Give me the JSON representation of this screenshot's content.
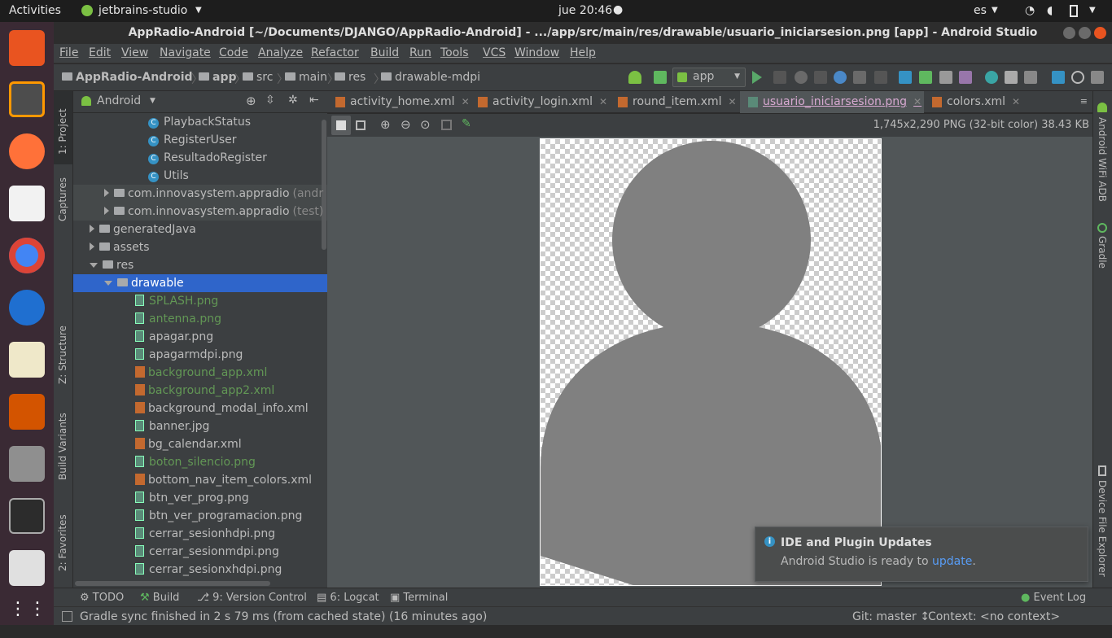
{
  "topbar": {
    "activities": "Activities",
    "app_name": "jetbrains-studio",
    "clock": "jue 20:46",
    "language": "es"
  },
  "dock": {
    "apps": [
      "software-store-icon",
      "sublime-text-icon",
      "firefox-icon",
      "document-viewer-icon",
      "chrome-icon",
      "thunderbird-icon",
      "text-editor-icon",
      "presentation-icon",
      "files-icon",
      "terminal-icon",
      "amazon-icon",
      "app-grid-icon"
    ]
  },
  "window": {
    "title": "AppRadio-Android [~/Documents/DJANGO/AppRadio-Android] - .../app/src/main/res/drawable/usuario_iniciarsesion.png [app] - Android Studio"
  },
  "menu": [
    "File",
    "Edit",
    "View",
    "Navigate",
    "Code",
    "Analyze",
    "Refactor",
    "Build",
    "Run",
    "Tools",
    "VCS",
    "Window",
    "Help"
  ],
  "breadcrumbs": [
    "AppRadio-Android",
    "app",
    "src",
    "main",
    "res",
    "drawable-mdpi"
  ],
  "run_config": "app",
  "left_tools": {
    "project": "1: Project",
    "captures": "Captures",
    "structure": "Z: Structure",
    "build_variants": "Build Variants",
    "favorites": "2: Favorites"
  },
  "project_panel": {
    "view_mode": "Android",
    "items": [
      {
        "label": "PlaybackStatus",
        "kind": "class",
        "depth": 5
      },
      {
        "label": "RegisterUser",
        "kind": "class",
        "depth": 5
      },
      {
        "label": "ResultadoRegister",
        "kind": "class",
        "depth": 5
      },
      {
        "label": "Utils",
        "kind": "class",
        "depth": 5
      },
      {
        "label": "com.innovasystem.appradio",
        "suffix": "(andr",
        "kind": "package",
        "depth": 2
      },
      {
        "label": "com.innovasystem.appradio",
        "suffix": "(test)",
        "kind": "package",
        "depth": 2
      },
      {
        "label": "generatedJava",
        "kind": "folder",
        "depth": 1
      },
      {
        "label": "assets",
        "kind": "folder",
        "depth": 1
      },
      {
        "label": "res",
        "kind": "folder-open",
        "depth": 1
      },
      {
        "label": "drawable",
        "kind": "folder-open",
        "depth": 2,
        "selected": true
      },
      {
        "label": "SPLASH.png",
        "kind": "png",
        "depth": 4,
        "green": true
      },
      {
        "label": "antenna.png",
        "kind": "png",
        "depth": 4,
        "green": true
      },
      {
        "label": "apagar.png",
        "kind": "png",
        "depth": 4
      },
      {
        "label": "apagarmdpi.png",
        "kind": "png",
        "depth": 4
      },
      {
        "label": "background_app.xml",
        "kind": "xml",
        "depth": 4,
        "green": true
      },
      {
        "label": "background_app2.xml",
        "kind": "xml",
        "depth": 4,
        "green": true
      },
      {
        "label": "background_modal_info.xml",
        "kind": "xml",
        "depth": 4
      },
      {
        "label": "banner.jpg",
        "kind": "png",
        "depth": 4
      },
      {
        "label": "bg_calendar.xml",
        "kind": "xml",
        "depth": 4
      },
      {
        "label": "boton_silencio.png",
        "kind": "png",
        "depth": 4,
        "green": true
      },
      {
        "label": "bottom_nav_item_colors.xml",
        "kind": "xml",
        "depth": 4
      },
      {
        "label": "btn_ver_prog.png",
        "kind": "png",
        "depth": 4
      },
      {
        "label": "btn_ver_programacion.png",
        "kind": "png",
        "depth": 4
      },
      {
        "label": "cerrar_sesionhdpi.png",
        "kind": "png",
        "depth": 4
      },
      {
        "label": "cerrar_sesionmdpi.png",
        "kind": "png",
        "depth": 4
      },
      {
        "label": "cerrar_sesionxhdpi.png",
        "kind": "png",
        "depth": 4
      }
    ]
  },
  "editor_tabs": [
    {
      "label": "activity_home.xml",
      "active": false
    },
    {
      "label": "activity_login.xml",
      "active": false
    },
    {
      "label": "round_item.xml",
      "active": false
    },
    {
      "label": "usuario_iniciarsesion.png",
      "active": true
    },
    {
      "label": "colors.xml",
      "active": false
    }
  ],
  "image_viewer": {
    "info": "1,745x2,290 PNG (32-bit color) 38.43 KB"
  },
  "right_tools": {
    "wifi_adb": "Android WiFi ADB",
    "gradle": "Gradle",
    "device_explorer": "Device File Explorer"
  },
  "notification": {
    "title": "IDE and Plugin Updates",
    "body": "Android Studio is ready to",
    "link": "update",
    "end": "."
  },
  "bottom_tools": {
    "todo": "TODO",
    "build": "Build",
    "version_control": "9: Version Control",
    "logcat": "6: Logcat",
    "terminal": "Terminal",
    "event_log": "Event Log"
  },
  "status": {
    "message": "Gradle sync finished in 2 s 79 ms (from cached state) (16 minutes ago)",
    "git": "Git: master ↕",
    "context": "Context: <no context>"
  },
  "colors": {
    "selection": "#2f65ca",
    "modified_file": "#629755",
    "link": "#589df6"
  }
}
